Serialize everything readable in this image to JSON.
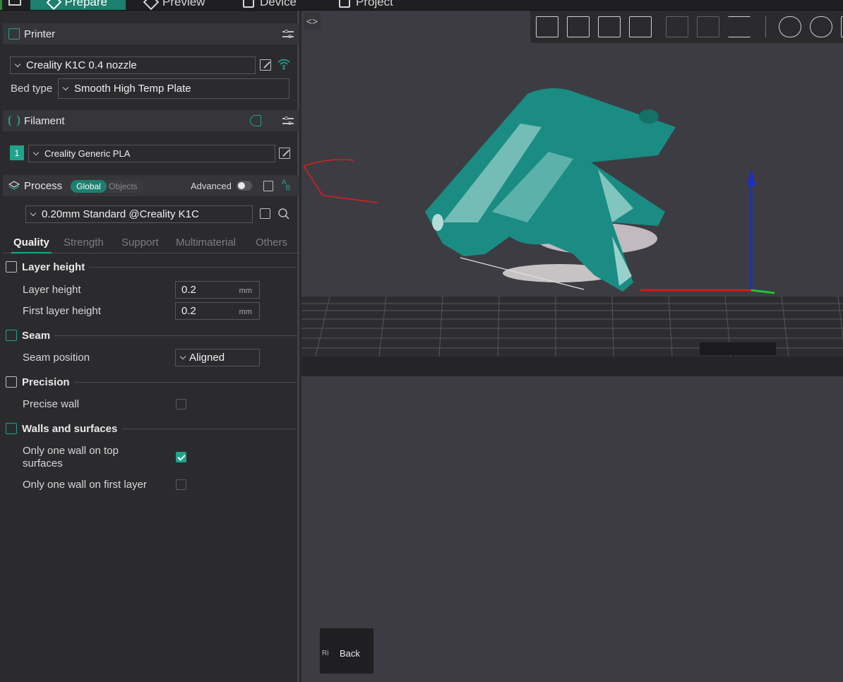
{
  "topbar": {
    "tabs": [
      "Prepare",
      "Preview",
      "Device",
      "Project"
    ]
  },
  "printer": {
    "section_label": "Printer",
    "selected": "Creality K1C 0.4 nozzle",
    "bed_type_label": "Bed type",
    "bed_type_value": "Smooth High Temp Plate"
  },
  "filament": {
    "section_label": "Filament",
    "slot_index": "1",
    "selected": "Creality Generic PLA"
  },
  "process": {
    "section_label": "Process",
    "mode_global": "Global",
    "mode_objects": "Objects",
    "advanced_label": "Advanced",
    "preset": "0.20mm Standard @Creality K1C",
    "tabs": [
      "Quality",
      "Strength",
      "Support",
      "Multimaterial",
      "Others"
    ]
  },
  "quality": {
    "layer_height_group": "Layer height",
    "layer_height_label": "Layer height",
    "layer_height_value": "0.2",
    "first_layer_height_label": "First layer height",
    "first_layer_height_value": "0.2",
    "unit_mm": "mm",
    "seam_group": "Seam",
    "seam_position_label": "Seam position",
    "seam_position_value": "Aligned",
    "precision_group": "Precision",
    "precise_wall_label": "Precise wall",
    "precise_wall_checked": false,
    "walls_group": "Walls and surfaces",
    "top_wall_label_1": "Only one wall on top",
    "top_wall_label_2": "surfaces",
    "top_wall_checked": true,
    "first_layer_wall_label": "Only one wall on first layer",
    "first_layer_wall_checked": false
  },
  "viewport": {
    "collapse_glyph": "<>",
    "navcube_face": "Back",
    "navcube_side": "Ri"
  },
  "colors": {
    "accent": "#1fa38c",
    "model": "#1a8c83",
    "annotation": "#d42020",
    "axis_z": "#1b2fc4",
    "axis_x": "#d11a1a",
    "axis_y": "#1ec432"
  }
}
